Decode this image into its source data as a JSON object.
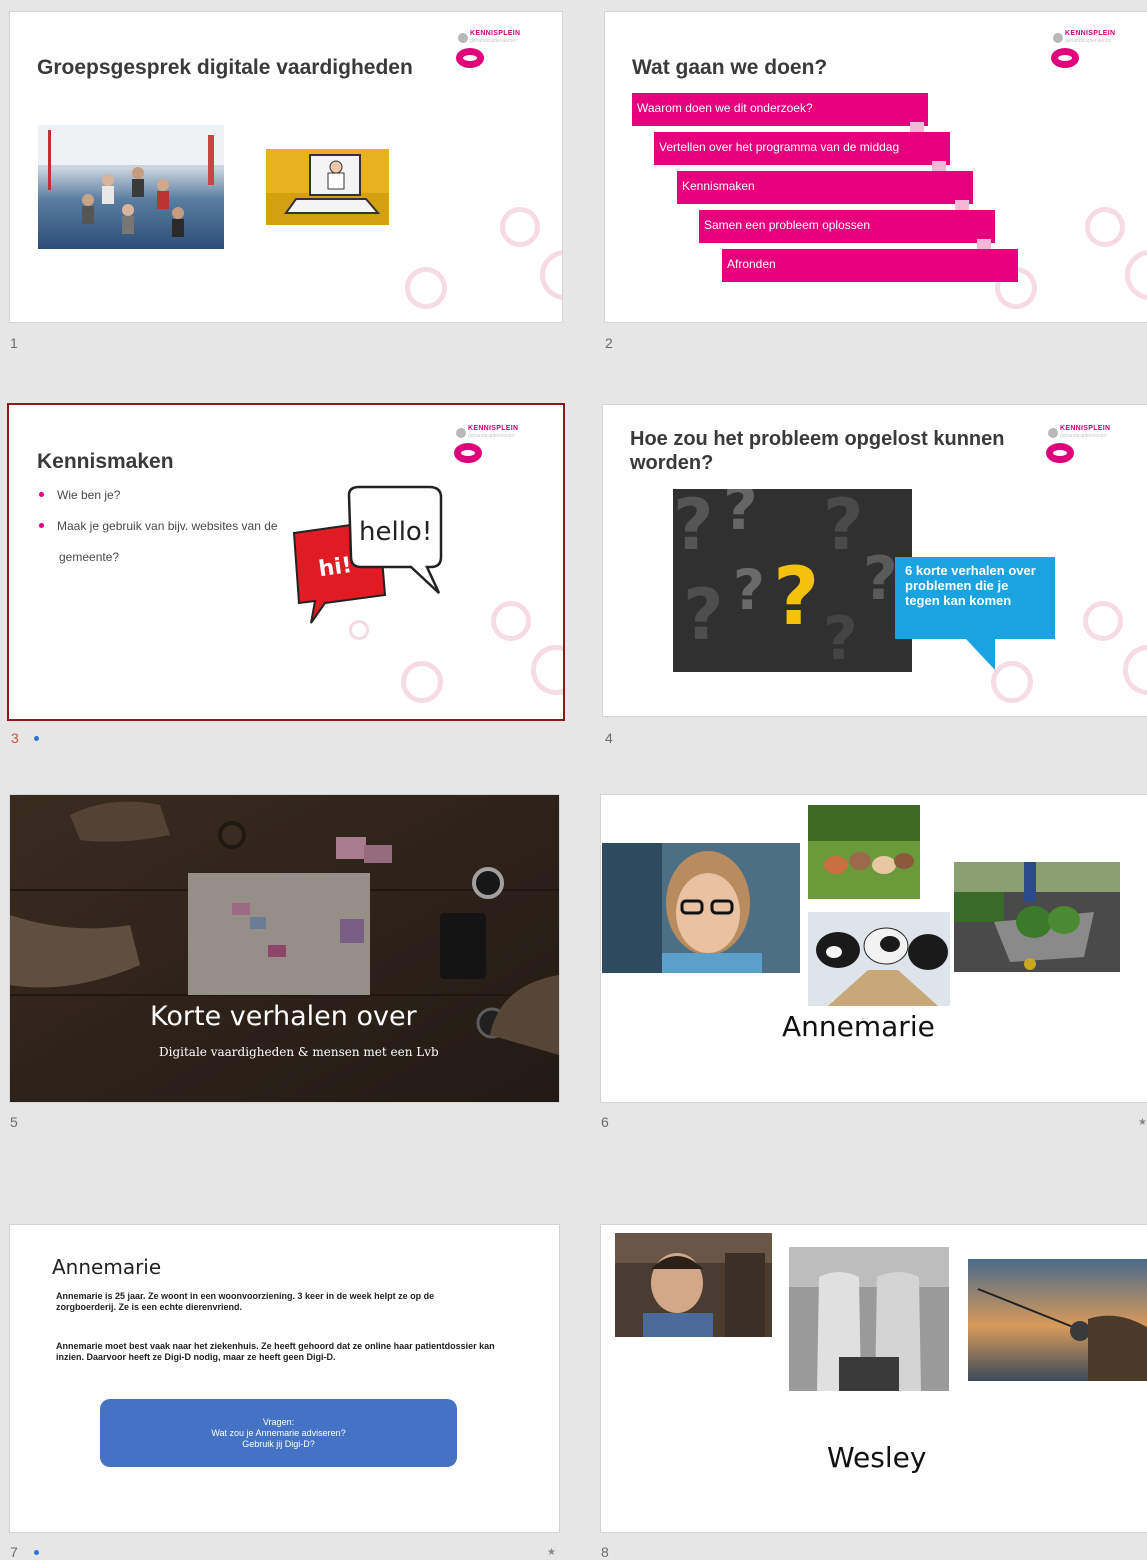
{
  "slides": [
    {
      "number": "1",
      "title": "Groepsgesprek digitale vaardigheden",
      "logo": {
        "name": "KENNISPLEIN",
        "sub": "gehandicaptensector"
      }
    },
    {
      "number": "2",
      "title": "Wat gaan we doen?",
      "logo": {
        "name": "KENNISPLEIN",
        "sub": "gehandicaptensector"
      },
      "steps": [
        "Waarom doen we dit onderzoek?",
        "Vertellen over het programma van de middag",
        "Kennismaken",
        "Samen een probleem oplossen",
        "Afronden"
      ]
    },
    {
      "number": "3",
      "title": "Kennismaken",
      "logo": {
        "name": "KENNISPLEIN",
        "sub": "gehandicaptensector"
      },
      "bullets": [
        "Wie ben je?",
        "Maak je gebruik van bijv. websites van de",
        "gemeente?"
      ],
      "bubble_hi": "hi!",
      "bubble_hello": "hello!"
    },
    {
      "number": "4",
      "title": "Hoe zou het probleem opgelost kunnen worden?",
      "logo": {
        "name": "KENNISPLEIN",
        "sub": "gehandicaptensector"
      },
      "callout": "6 korte verhalen over problemen die je tegen kan komen"
    },
    {
      "number": "5",
      "title": "Korte verhalen over",
      "subtitle": "Digitale vaardigheden & mensen met een Lvb"
    },
    {
      "number": "6",
      "caption": "Annemarie"
    },
    {
      "number": "7",
      "title": "Annemarie",
      "para1": "Annemarie is 25 jaar. Ze woont in een woonvoorziening. 3 keer in de week helpt ze op de zorgboerderij. Ze is een echte dierenvriend.",
      "para2": "Annemarie moet best vaak naar het ziekenhuis. Ze heeft gehoord dat ze online haar patientdossier kan inzien. Daarvoor heeft ze Digi-D nodig, maar ze heeft geen Digi-D.",
      "questions": [
        "Vragen:",
        "Wat zou je Annemarie adviseren?",
        "Gebruik jij Digi-D?"
      ]
    },
    {
      "number": "8",
      "caption": "Wesley"
    }
  ],
  "colors": {
    "magenta": "#e6007e",
    "blue": "#1aa3e0",
    "button_blue": "#4472c4",
    "selected_border": "#8b1a1a"
  }
}
